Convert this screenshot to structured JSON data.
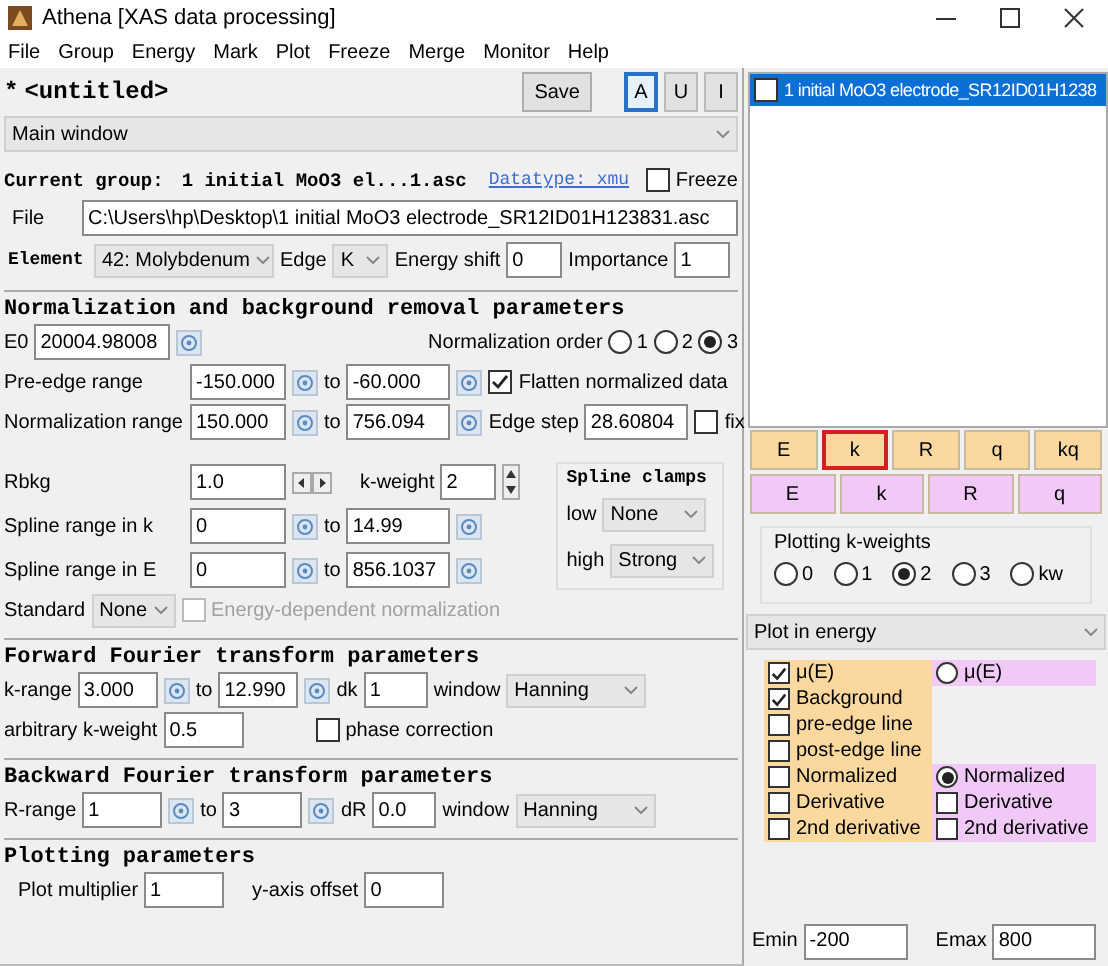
{
  "window": {
    "title": "Athena [XAS data processing]"
  },
  "menu": [
    "File",
    "Group",
    "Energy",
    "Mark",
    "Plot",
    "Freeze",
    "Merge",
    "Monitor",
    "Help"
  ],
  "project": {
    "modified_mark": "*",
    "name": "<untitled>"
  },
  "save_button": "Save",
  "modes": [
    {
      "label": "A",
      "selected": true
    },
    {
      "label": "U",
      "selected": false
    },
    {
      "label": "I",
      "selected": false
    }
  ],
  "view": "Main window",
  "current_group": {
    "label": "Current group:",
    "name": "1 initial MoO3 el...1.asc",
    "datatype": "Datatype: xmu",
    "freeze": {
      "label": "Freeze",
      "checked": false
    }
  },
  "file": {
    "label": "File",
    "value": "C:\\Users\\hp\\Desktop\\1 initial MoO3 electrode_SR12ID01H123831.asc"
  },
  "element": {
    "label": "Element",
    "value": "42: Molybdenum"
  },
  "edge": {
    "label": "Edge",
    "value": "K"
  },
  "energy_shift": {
    "label": "Energy shift",
    "value": "0"
  },
  "importance": {
    "label": "Importance",
    "value": "1"
  },
  "normalization": {
    "title": "Normalization and background removal parameters",
    "e0": {
      "label": "E0",
      "value": "20004.98008"
    },
    "order": {
      "label": "Normalization order",
      "options": [
        {
          "label": "1",
          "selected": false
        },
        {
          "label": "2",
          "selected": false
        },
        {
          "label": "3",
          "selected": true
        }
      ]
    },
    "pre_edge": {
      "label": "Pre-edge range",
      "from": "-150.000",
      "to_label": "to",
      "to": "-60.000"
    },
    "flatten": {
      "label": "Flatten normalized data",
      "checked": true
    },
    "norm_range": {
      "label": "Normalization range",
      "from": "150.000",
      "to_label": "to",
      "to": "756.094"
    },
    "edge_step": {
      "label": "Edge step",
      "value": "28.60804"
    },
    "fix": {
      "label": "fix",
      "checked": false
    },
    "rbkg": {
      "label": "Rbkg",
      "value": "1.0"
    },
    "k_weight": {
      "label": "k-weight",
      "value": "2"
    },
    "spline_clamps": {
      "title": "Spline clamps",
      "low": {
        "label": "low",
        "value": "None"
      },
      "high": {
        "label": "high",
        "value": "Strong"
      }
    },
    "spline_k": {
      "label": "Spline range in k",
      "from": "0",
      "to_label": "to",
      "to": "14.99"
    },
    "spline_e": {
      "label": "Spline range in E",
      "from": "0",
      "to_label": "to",
      "to": "856.1037"
    },
    "standard": {
      "label": "Standard",
      "value": "None"
    },
    "energy_dependent": {
      "label": "Energy-dependent normalization",
      "checked": false,
      "disabled": true
    }
  },
  "forward": {
    "title": "Forward Fourier transform parameters",
    "k_range": {
      "label": "k-range",
      "from": "3.000",
      "to_label": "to",
      "to": "12.990"
    },
    "dk": {
      "label": "dk",
      "value": "1"
    },
    "window": {
      "label": "window",
      "value": "Hanning"
    },
    "arbitrary_k_weight": {
      "label": "arbitrary k-weight",
      "value": "0.5"
    },
    "phase_correction": {
      "label": "phase correction",
      "checked": false
    }
  },
  "backward": {
    "title": "Backward Fourier transform parameters",
    "r_range": {
      "label": "R-range",
      "from": "1",
      "to_label": "to",
      "to": "3"
    },
    "dr": {
      "label": "dR",
      "value": "0.0"
    },
    "window": {
      "label": "window",
      "value": "Hanning"
    }
  },
  "plotting": {
    "title": "Plotting parameters",
    "multiplier": {
      "label": "Plot multiplier",
      "value": "1"
    },
    "y_offset": {
      "label": "y-axis offset",
      "value": "0"
    }
  },
  "groups": [
    {
      "label": "1 initial MoO3 electrode_SR12ID01H1238",
      "selected": true,
      "checked": false
    }
  ],
  "plot_rows": [
    {
      "color": "#fbd99e",
      "buttons": [
        {
          "label": "E",
          "highlighted": false
        },
        {
          "label": "k",
          "highlighted": true
        },
        {
          "label": "R",
          "highlighted": false
        },
        {
          "label": "q",
          "highlighted": false
        },
        {
          "label": "kq",
          "highlighted": false
        }
      ]
    },
    {
      "color": "#f0c9f7",
      "buttons": [
        {
          "label": "E",
          "highlighted": false
        },
        {
          "label": "k",
          "highlighted": false
        },
        {
          "label": "R",
          "highlighted": false
        },
        {
          "label": "q",
          "highlighted": false
        }
      ]
    }
  ],
  "k_weights": {
    "title": "Plotting k-weights",
    "options": [
      {
        "label": "0",
        "selected": false
      },
      {
        "label": "1",
        "selected": false
      },
      {
        "label": "2",
        "selected": true
      },
      {
        "label": "3",
        "selected": false
      },
      {
        "label": "kw",
        "selected": false
      }
    ]
  },
  "plot_mode": "Plot in energy",
  "energy_plot": [
    {
      "left": {
        "kind": "checkbox",
        "label": "μ(E)",
        "checked": true
      },
      "right": {
        "kind": "radio",
        "label": "μ(E)",
        "selected": false
      }
    },
    {
      "left": {
        "kind": "checkbox",
        "label": "Background",
        "checked": true
      }
    },
    {
      "left": {
        "kind": "checkbox",
        "label": "pre-edge line",
        "checked": false
      }
    },
    {
      "left": {
        "kind": "checkbox",
        "label": "post-edge line",
        "checked": false
      }
    },
    {
      "left": {
        "kind": "checkbox",
        "label": "Normalized",
        "checked": false
      },
      "right": {
        "kind": "radio",
        "label": "Normalized",
        "selected": true
      }
    },
    {
      "left": {
        "kind": "checkbox",
        "label": "Derivative",
        "checked": false
      },
      "right": {
        "kind": "checkbox",
        "label": "Derivative",
        "checked": false
      }
    },
    {
      "left": {
        "kind": "checkbox",
        "label": "2nd derivative",
        "checked": false
      },
      "right": {
        "kind": "checkbox",
        "label": "2nd derivative",
        "checked": false
      }
    }
  ],
  "emin": {
    "label": "Emin",
    "value": "-200"
  },
  "emax": {
    "label": "Emax",
    "value": "800"
  }
}
